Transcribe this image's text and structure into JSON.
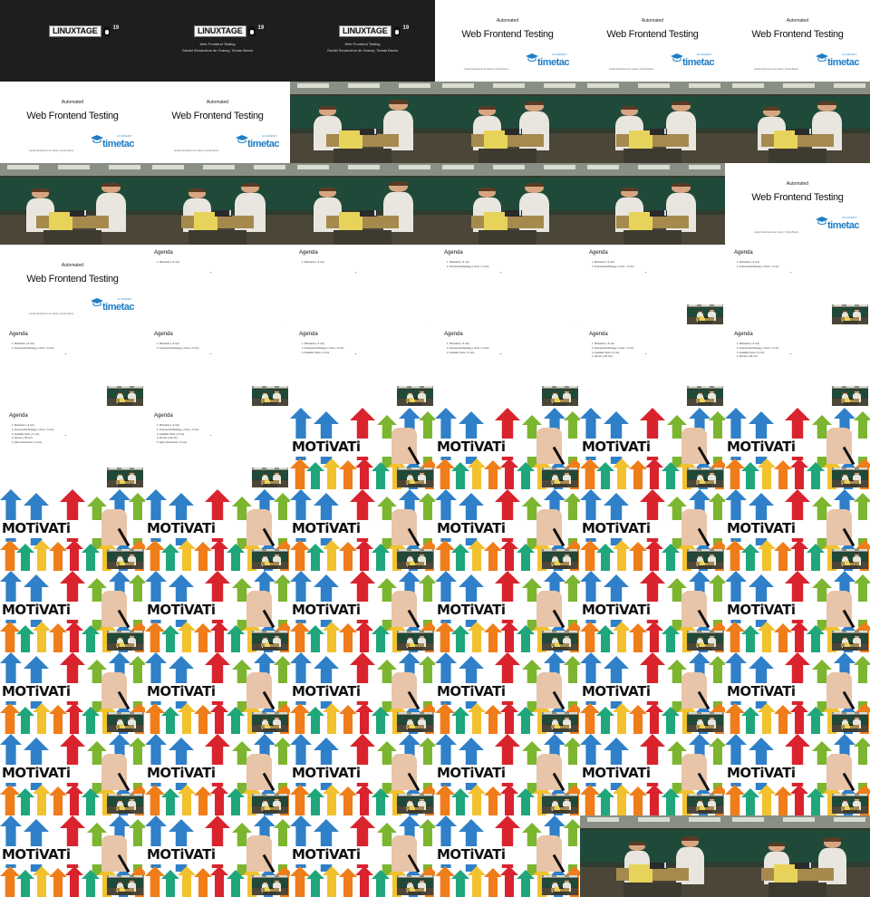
{
  "grid": {
    "columns": 6,
    "rows": 11
  },
  "title_card": {
    "logo_text": "LINUXTAGE",
    "year": "19",
    "talk": "Web Frontend Testing",
    "speakers": "Gerald Senarclens de Grancy, Tomas Bezos"
  },
  "slide_title": {
    "pre": "Automated",
    "title": "Web Frontend Testing",
    "footer": "Gerald Senarclens de Grancy, Tomas Bezos",
    "logo_academy": "ACADEMY",
    "logo_word": "timetac"
  },
  "agenda": {
    "heading": "Agenda",
    "items": [
      "1. Motivation (~5 min)",
      "2. Frameworks/Strategy (~5min + 5 min)",
      "3. Available Tools (~5 min)",
      "4. Demos (~30 min)",
      "5. Q&A / Discussion (~5 min)"
    ]
  },
  "motivation": {
    "word": "MOTiVATi"
  },
  "colors": {
    "title_bg": "#1e1e1e",
    "timetac_blue": "#1f7dc5",
    "stage_board": "#1f4a39",
    "arrow_blue": "#2f80c8",
    "arrow_red": "#d9232d",
    "arrow_green": "#7cb52f",
    "arrow_orange": "#ef7d1a",
    "arrow_yellow": "#f2c12e",
    "arrow_teal": "#1fa67a"
  },
  "tiles": [
    {
      "kind": "title_card",
      "layout": "logo"
    },
    {
      "kind": "title_card",
      "layout": "full"
    },
    {
      "kind": "title_card",
      "layout": "full"
    },
    {
      "kind": "slide_title"
    },
    {
      "kind": "slide_title"
    },
    {
      "kind": "slide_title"
    },
    {
      "kind": "slide_title"
    },
    {
      "kind": "slide_title"
    },
    {
      "kind": "stage",
      "variant": 0
    },
    {
      "kind": "stage",
      "variant": 1
    },
    {
      "kind": "stage",
      "variant": 2
    },
    {
      "kind": "stage",
      "variant": 3
    },
    {
      "kind": "stage",
      "variant": 4
    },
    {
      "kind": "stage",
      "variant": 5
    },
    {
      "kind": "stage",
      "variant": 0
    },
    {
      "kind": "stage",
      "variant": 1
    },
    {
      "kind": "stage",
      "variant": 2
    },
    {
      "kind": "slide_title"
    },
    {
      "kind": "slide_title"
    },
    {
      "kind": "agenda",
      "items": 1,
      "inset": false
    },
    {
      "kind": "agenda",
      "items": 1,
      "inset": false
    },
    {
      "kind": "agenda",
      "items": 2,
      "inset": false
    },
    {
      "kind": "agenda",
      "items": 2,
      "inset": true
    },
    {
      "kind": "agenda",
      "items": 2,
      "inset": true
    },
    {
      "kind": "agenda",
      "items": 2,
      "inset": true
    },
    {
      "kind": "agenda",
      "items": 2,
      "inset": true
    },
    {
      "kind": "agenda",
      "items": 3,
      "inset": true
    },
    {
      "kind": "agenda",
      "items": 3,
      "inset": true
    },
    {
      "kind": "agenda",
      "items": 4,
      "inset": true
    },
    {
      "kind": "agenda",
      "items": 4,
      "inset": true
    },
    {
      "kind": "agenda",
      "items": 5,
      "inset": true
    },
    {
      "kind": "agenda",
      "items": 5,
      "inset": true
    },
    {
      "kind": "motivation"
    },
    {
      "kind": "motivation"
    },
    {
      "kind": "motivation"
    },
    {
      "kind": "motivation"
    },
    {
      "kind": "motivation"
    },
    {
      "kind": "motivation"
    },
    {
      "kind": "motivation"
    },
    {
      "kind": "motivation"
    },
    {
      "kind": "motivation"
    },
    {
      "kind": "motivation"
    },
    {
      "kind": "motivation"
    },
    {
      "kind": "motivation"
    },
    {
      "kind": "motivation"
    },
    {
      "kind": "motivation"
    },
    {
      "kind": "motivation"
    },
    {
      "kind": "motivation"
    },
    {
      "kind": "motivation"
    },
    {
      "kind": "motivation"
    },
    {
      "kind": "motivation"
    },
    {
      "kind": "motivation"
    },
    {
      "kind": "motivation"
    },
    {
      "kind": "motivation"
    },
    {
      "kind": "motivation"
    },
    {
      "kind": "motivation"
    },
    {
      "kind": "motivation"
    },
    {
      "kind": "motivation"
    },
    {
      "kind": "motivation"
    },
    {
      "kind": "motivation"
    },
    {
      "kind": "motivation"
    },
    {
      "kind": "motivation"
    },
    {
      "kind": "motivation"
    },
    {
      "kind": "motivation"
    },
    {
      "kind": "stage",
      "variant": 6
    },
    {
      "kind": "stage",
      "variant": 7
    }
  ]
}
